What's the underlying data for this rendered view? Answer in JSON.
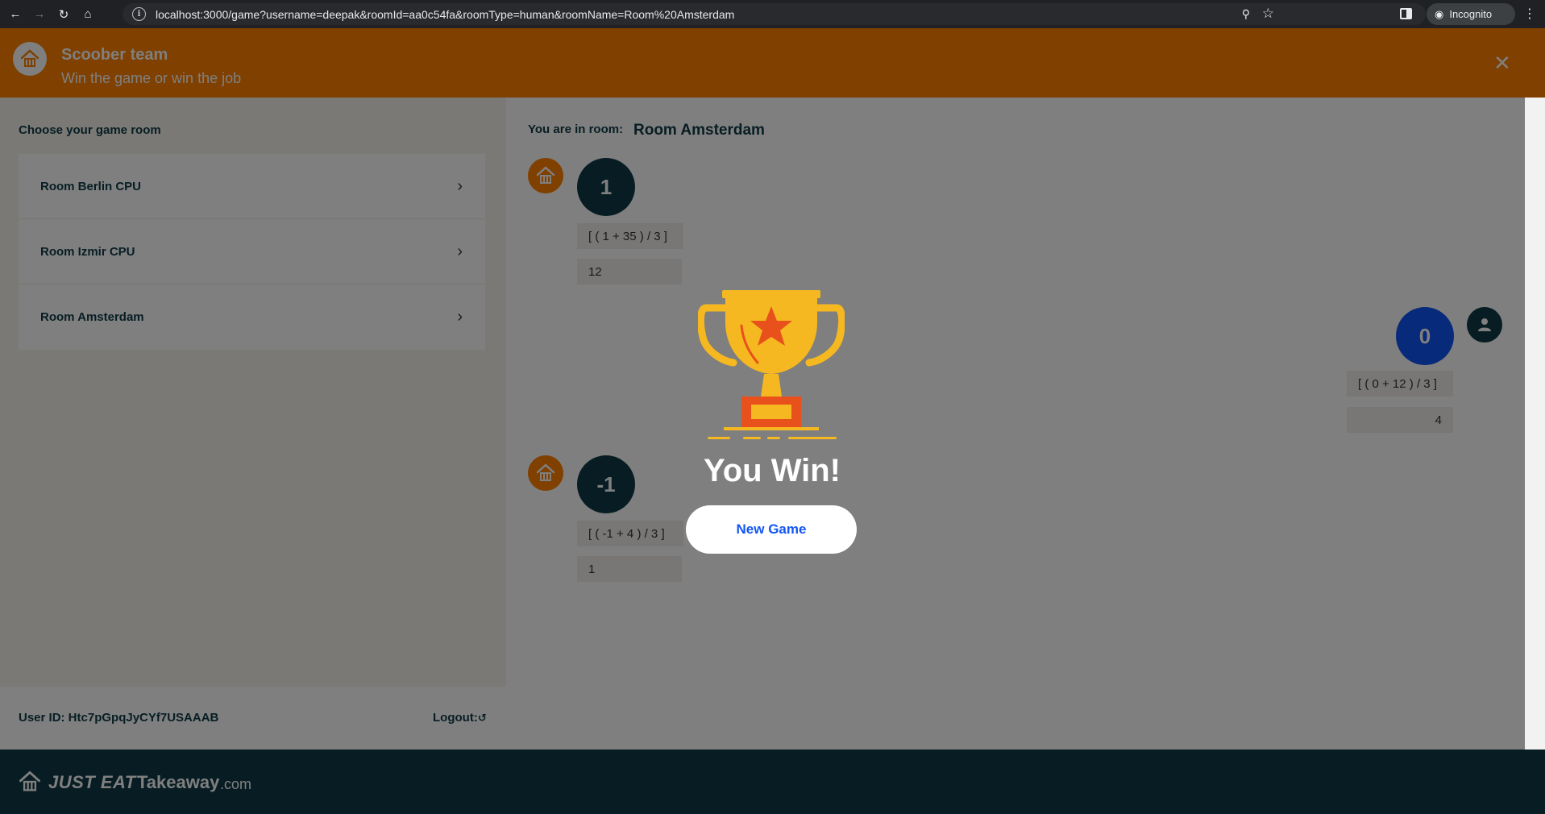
{
  "browser": {
    "url": "localhost:3000/game?username=deepak&roomId=aa0c54fa&roomType=human&roomName=Room%20Amsterdam",
    "incognito_label": "Incognito"
  },
  "header": {
    "title": "Scoober team",
    "subtitle": "Win the game or win the job"
  },
  "sidebar": {
    "heading": "Choose your game room",
    "rooms": [
      {
        "label": "Room Berlin CPU"
      },
      {
        "label": "Room Izmir CPU"
      },
      {
        "label": "Room Amsterdam"
      }
    ],
    "user_id": "User ID: Htc7pGpqJyCYf7USAAAB",
    "logout_label": "Logout:"
  },
  "game": {
    "room_caption": "You are in room:",
    "room_name": "Room Amsterdam",
    "moves": [
      {
        "player": "cpu",
        "number": "1",
        "formula": "[ ( 1 + 35 ) / 3 ]",
        "result": "12"
      },
      {
        "player": "me",
        "number": "0",
        "formula": "[ ( 0 + 12 ) / 3 ]",
        "result": "4"
      },
      {
        "player": "cpu",
        "number": "-1",
        "formula": "[ ( -1 + 4 ) / 3 ]",
        "result": "1"
      }
    ]
  },
  "result_modal": {
    "message": "You Win!",
    "button_label": "New Game"
  },
  "footer": {
    "brand_just": "JUST EAT",
    "brand_takeaway": "Takeaway",
    "brand_com": ".com"
  },
  "colors": {
    "brand_orange": "#ff8000",
    "dark_teal": "#0f3b46",
    "player_blue": "#1155f5"
  }
}
